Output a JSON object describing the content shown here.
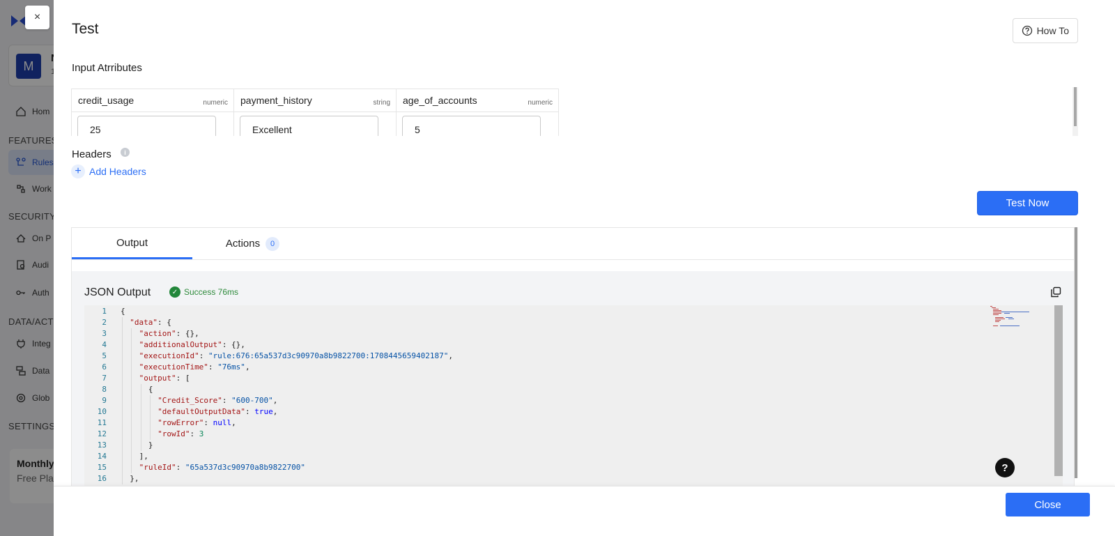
{
  "background": {
    "avatar_letter": "M",
    "card_name": "N",
    "card_sub": "1",
    "sections": [
      "FEATURES",
      "SECURITY",
      "DATA/ACTI",
      "SETTINGS"
    ],
    "items": [
      "Hom",
      "Rules",
      "Work",
      "On P",
      "Audi",
      "Auth",
      "Integ",
      "Data",
      "Glob"
    ],
    "usage_title": "Monthly Usage",
    "usage_plan": "Free Pla"
  },
  "drawer": {
    "dismiss_glyph": "×",
    "title": "Test",
    "howto_label": "How To",
    "input_attributes_label": "Input Atrributes",
    "attributes": [
      {
        "name": "credit_usage",
        "type": "numeric",
        "value": "25"
      },
      {
        "name": "payment_history",
        "type": "string",
        "value": "Excellent"
      },
      {
        "name": "age_of_accounts",
        "type": "numeric",
        "value": "5"
      }
    ],
    "headers_label": "Headers",
    "add_headers_label": "Add Headers",
    "test_now_label": "Test Now",
    "tabs": [
      {
        "label": "Output"
      },
      {
        "label": "Actions",
        "badge": "0"
      }
    ],
    "json_output_label": "JSON Output",
    "status_text": "Success 76ms",
    "close_label": "Close",
    "help_glyph": "?"
  },
  "json_lines": [
    {
      "n": "1",
      "indent": 0,
      "parts": [
        [
          "p",
          "{"
        ]
      ]
    },
    {
      "n": "2",
      "indent": 1,
      "parts": [
        [
          "k",
          "\"data\""
        ],
        [
          "p",
          ": {"
        ]
      ]
    },
    {
      "n": "3",
      "indent": 2,
      "parts": [
        [
          "k",
          "\"action\""
        ],
        [
          "p",
          ": {},"
        ]
      ]
    },
    {
      "n": "4",
      "indent": 2,
      "parts": [
        [
          "k",
          "\"additionalOutput\""
        ],
        [
          "p",
          ": {},"
        ]
      ]
    },
    {
      "n": "5",
      "indent": 2,
      "parts": [
        [
          "k",
          "\"executionId\""
        ],
        [
          "p",
          ": "
        ],
        [
          "s",
          "\"rule:676:65a537d3c90970a8b9822700:1708445659402187\""
        ],
        [
          "p",
          ","
        ]
      ]
    },
    {
      "n": "6",
      "indent": 2,
      "parts": [
        [
          "k",
          "\"executionTime\""
        ],
        [
          "p",
          ": "
        ],
        [
          "s",
          "\"76ms\""
        ],
        [
          "p",
          ","
        ]
      ]
    },
    {
      "n": "7",
      "indent": 2,
      "parts": [
        [
          "k",
          "\"output\""
        ],
        [
          "p",
          ": ["
        ]
      ]
    },
    {
      "n": "8",
      "indent": 3,
      "parts": [
        [
          "p",
          "{"
        ]
      ]
    },
    {
      "n": "9",
      "indent": 4,
      "parts": [
        [
          "k",
          "\"Credit_Score\""
        ],
        [
          "p",
          ": "
        ],
        [
          "s",
          "\"600-700\""
        ],
        [
          "p",
          ","
        ]
      ]
    },
    {
      "n": "10",
      "indent": 4,
      "parts": [
        [
          "k",
          "\"defaultOutputData\""
        ],
        [
          "p",
          ": "
        ],
        [
          "b",
          "true"
        ],
        [
          "p",
          ","
        ]
      ]
    },
    {
      "n": "11",
      "indent": 4,
      "parts": [
        [
          "k",
          "\"rowError\""
        ],
        [
          "p",
          ": "
        ],
        [
          "b",
          "null"
        ],
        [
          "p",
          ","
        ]
      ]
    },
    {
      "n": "12",
      "indent": 4,
      "parts": [
        [
          "k",
          "\"rowId\""
        ],
        [
          "p",
          ": "
        ],
        [
          "n",
          "3"
        ]
      ]
    },
    {
      "n": "13",
      "indent": 3,
      "parts": [
        [
          "p",
          "}"
        ]
      ]
    },
    {
      "n": "14",
      "indent": 2,
      "parts": [
        [
          "p",
          "],"
        ]
      ]
    },
    {
      "n": "15",
      "indent": 2,
      "parts": [
        [
          "k",
          "\"ruleId\""
        ],
        [
          "p",
          ": "
        ],
        [
          "s",
          "\"65a537d3c90970a8b9822700\""
        ]
      ]
    },
    {
      "n": "16",
      "indent": 1,
      "parts": [
        [
          "p",
          "},"
        ]
      ]
    }
  ],
  "colors": {
    "accent": "#2b6ef5",
    "success": "#22863a"
  }
}
